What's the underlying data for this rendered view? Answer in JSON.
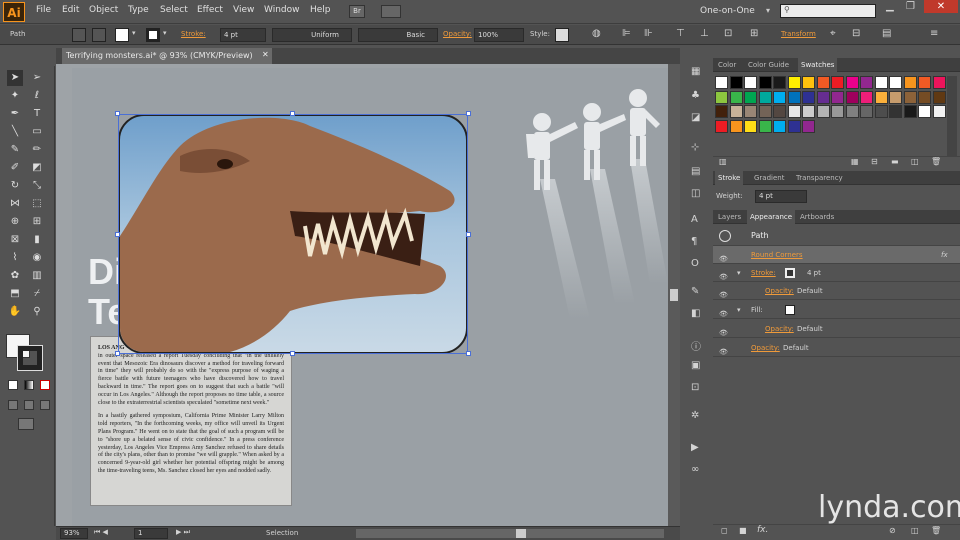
{
  "app": {
    "logo": "Ai",
    "workspace": "One-on-One",
    "search_placeholder": ""
  },
  "menu": [
    "File",
    "Edit",
    "Object",
    "Type",
    "Select",
    "Effect",
    "View",
    "Window",
    "Help"
  ],
  "control": {
    "selection_label": "Path",
    "stroke_label": "Stroke:",
    "stroke_value": "4 pt",
    "profile": "Uniform",
    "brush": "Basic",
    "opacity_label": "Opacity:",
    "opacity_value": "100%",
    "style_label": "Style:",
    "transform_label": "Transform"
  },
  "document": {
    "tab_title": "Terrifying monsters.ai* @ 93% (CMYK/Preview)",
    "zoom": "93%",
    "page": "1",
    "status": "Selection"
  },
  "artwork": {
    "headline_part1": "Di",
    "headline_part2": "Te",
    "dateline": "LOS ANG",
    "para1": "in outer space released a report Tuesday concluding that \"in the unlikely event that Mesozoic Era dinosaurs discover a method for traveling forward in time\" they will probably do so with the \"express purpose of waging a fierce battle with future teenagers who have discovered how to travel backward in time.\" The report goes on to suggest that such a battle \"will occur in Los Angeles.\" Although the report proposes no time table, a source close to the extraterrestrial scientists speculated \"sometime next week.\"",
    "para2": "In a hastily gathered symposium, California Prime Minister Larry Milton told reporters, \"In the forthcoming weeks, my office will unveil its Urgent Plans Program.\" He went on to state that the goal of such a program will be to \"shore up a belated sense of civic confidence.\" In a press conference yesterday, Los Angeles Vice Empress Amy Sanchez refused to share details of the city's plans, other than to promise \"we will grapple.\" When asked by a concerned 9-year-old girl whether her potential offspring might be among the time-traveling teens, Ms. Sanchez closed her eyes and nodded sadly."
  },
  "swatch_panel": {
    "tabs": [
      "Color",
      "Color Guide",
      "Swatches"
    ],
    "colors": [
      "#ffffff",
      "#000000",
      "#ffffff",
      "#000000",
      "#1a1a1a",
      "#ffef00",
      "#ffc20e",
      "#f15a24",
      "#ed1c24",
      "#ec008c",
      "#92278f",
      "#ffffff",
      "#ffffff",
      "#f7941d",
      "#f15a24",
      "#ed145b",
      "#8dc63f",
      "#39b54a",
      "#00a651",
      "#00a99d",
      "#00aeef",
      "#0072bc",
      "#2e3192",
      "#662d91",
      "#92278f",
      "#9e005d",
      "#ed1e79",
      "#fbb03b",
      "#c69c6d",
      "#8c6239",
      "#754c24",
      "#603913",
      "#42210b",
      "#c7b299",
      "#998675",
      "#736357",
      "#534741",
      "#e6e6e6",
      "#cccccc",
      "#b3b3b3",
      "#999999",
      "#808080",
      "#666666",
      "#4d4d4d",
      "#333333",
      "#1a1a1a",
      "#ffffff",
      "#f2f2f2",
      "#ed1c24",
      "#f7941d",
      "#ffde17",
      "#39b54a",
      "#00aeef",
      "#2e3192",
      "#92278f"
    ]
  },
  "stroke_panel": {
    "tabs": [
      "Stroke",
      "Gradient",
      "Transparency"
    ],
    "weight_label": "Weight:",
    "weight_value": "4 pt"
  },
  "appearance_panel": {
    "tabs": [
      "Layers",
      "Appearance",
      "Artboards"
    ],
    "object": "Path",
    "rows": [
      {
        "label": "Round Corners",
        "value": "",
        "fx": "fx"
      },
      {
        "label": "Stroke:",
        "value": "4 pt"
      },
      {
        "label": "Opacity:",
        "value": "Default"
      },
      {
        "label": "Fill:",
        "value": ""
      },
      {
        "label": "Opacity:",
        "value": "Default"
      },
      {
        "label": "Opacity:",
        "value": "Default"
      }
    ]
  },
  "watermark": "lynda.com",
  "colors": {
    "accent": "#ef9a3a",
    "selection": "#4a6fd6"
  }
}
